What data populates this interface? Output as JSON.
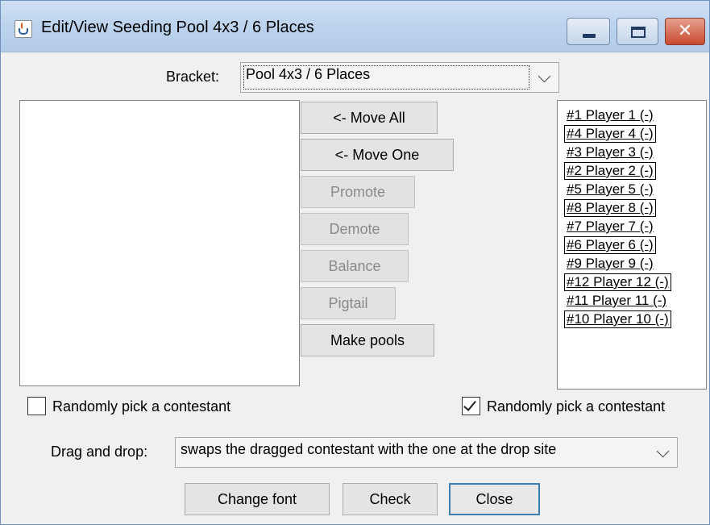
{
  "window": {
    "title": "Edit/View Seeding Pool 4x3 / 6 Places",
    "icon": "java-cup-icon",
    "controls": {
      "minimize": "minimize-icon",
      "maximize": "maximize-icon",
      "close": "✕"
    }
  },
  "bracket": {
    "label": "Bracket:",
    "selected": "Pool 4x3 / 6 Places"
  },
  "buttons": {
    "move_all": "<- Move All",
    "move_one": "<- Move One",
    "promote": "Promote",
    "demote": "Demote",
    "balance": "Balance",
    "pigtail": "Pigtail",
    "make_pools": "Make pools"
  },
  "left_list": {
    "items": []
  },
  "right_list": {
    "items": [
      {
        "label": "#1 Player 1 (-)",
        "boxed": false
      },
      {
        "label": "#4 Player 4 (-)",
        "boxed": true
      },
      {
        "label": "#3 Player 3 (-)",
        "boxed": false
      },
      {
        "label": "#2 Player 2 (-)",
        "boxed": true
      },
      {
        "label": "#5 Player 5 (-)",
        "boxed": false
      },
      {
        "label": "#8 Player 8 (-)",
        "boxed": true
      },
      {
        "label": "#7 Player 7 (-)",
        "boxed": false
      },
      {
        "label": "#6 Player 6 (-)",
        "boxed": true
      },
      {
        "label": "#9 Player 9 (-)",
        "boxed": false
      },
      {
        "label": "#12 Player 12 (-)",
        "boxed": true
      },
      {
        "label": "#11 Player 11 (-)",
        "boxed": false
      },
      {
        "label": "#10 Player 10 (-)",
        "boxed": true
      }
    ]
  },
  "random_left": {
    "label": "Randomly pick a contestant",
    "checked": false
  },
  "random_right": {
    "label": "Randomly pick a contestant",
    "checked": true
  },
  "drag_drop": {
    "label": "Drag and drop:",
    "selected": "swaps the dragged contestant with the one at the drop site"
  },
  "footer": {
    "change_font": "Change font",
    "check": "Check",
    "close": "Close"
  }
}
